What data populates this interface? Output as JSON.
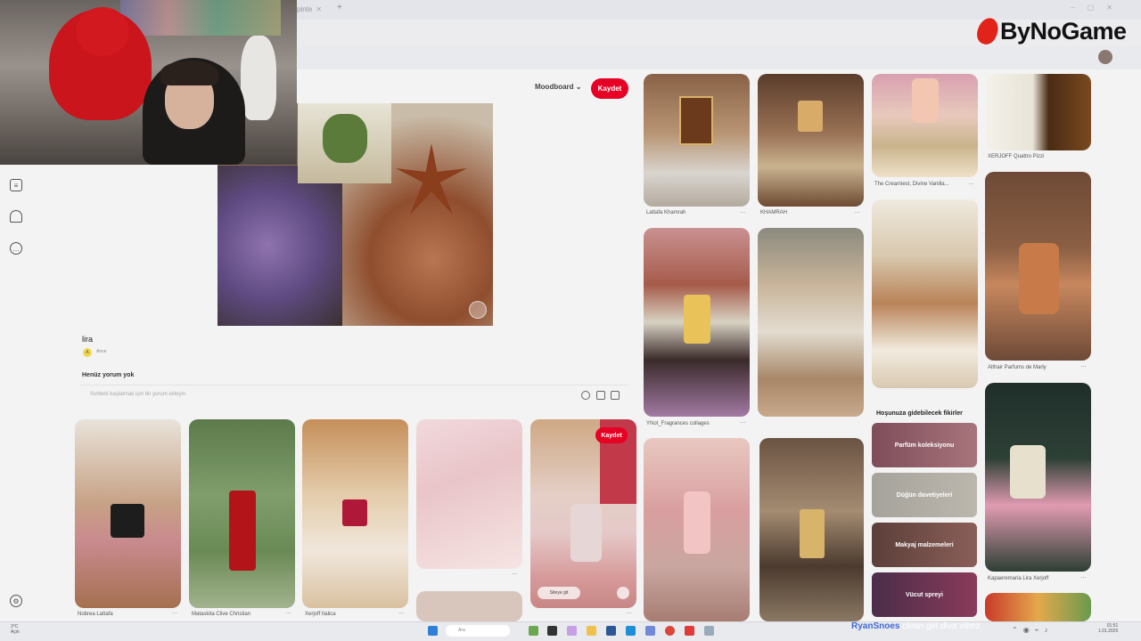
{
  "browser": {
    "tab_title": "pinte"
  },
  "overlay": {
    "logo_text": "ByNoGame",
    "streamer_user": "RyanSnoes",
    "streamer_message": "clean girl diva vibez"
  },
  "pin_detail": {
    "board_dropdown": "Moodboard",
    "save_label": "Kaydet",
    "title": "lira",
    "author": "Ance",
    "author_initial": "A",
    "comments_heading": "Henüz yorum yok",
    "comment_placeholder": "Sohbeti başlatmak için bir yorum ekleyin"
  },
  "related_pins": [
    {
      "caption": "Nobrea Lattafa"
    },
    {
      "caption": "Mataskita Clive Christian"
    },
    {
      "caption": "Xerjoff Italica"
    },
    {
      "caption": ""
    },
    {
      "caption": "",
      "save_label": "Kaydet",
      "link_label": "Siteye git"
    }
  ],
  "right_pins": [
    {
      "caption": "Lattafa Khamrah"
    },
    {
      "caption": "KHAMRAH"
    },
    {
      "caption": "The Creamiest, Divine Vanilla..."
    },
    {
      "caption": "XERJOFF Quattro Pizzi"
    },
    {
      "caption": "Althair Parfums de Marly"
    },
    {
      "caption": "YNot_Fragrances collages"
    },
    {
      "caption": "Kapaeremaria Lira Xerjoff"
    }
  ],
  "suggestions": {
    "heading": "Hoşunuza gidebilecek fikirler",
    "items": [
      "Parfüm koleksiyonu",
      "Düğün davetiyeleri",
      "Makyaj malzemeleri",
      "Vücut spreyi"
    ]
  },
  "taskbar": {
    "weather_temp": "3°C",
    "weather_desc": "Açık",
    "search_placeholder": "Ara",
    "time": "01:51",
    "date": "1.01.2025"
  }
}
